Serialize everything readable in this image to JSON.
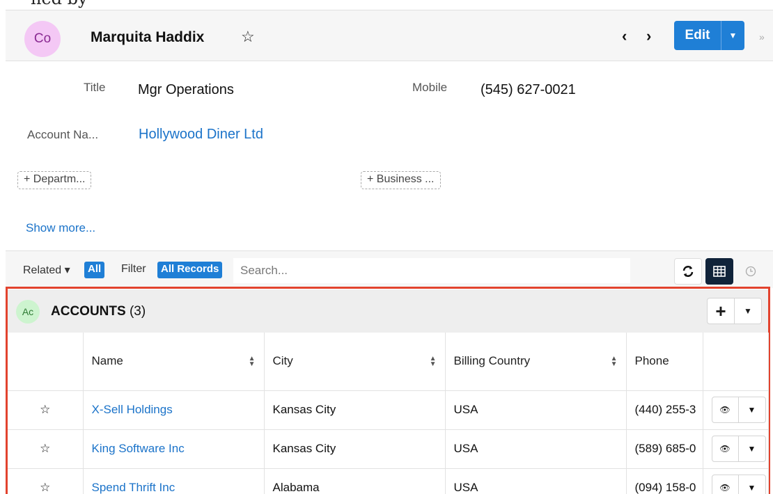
{
  "header": {
    "avatar_initials": "Co",
    "record_name": "Marquita Haddix",
    "favorite_icon": "star-outline-icon",
    "prev_icon": "chevron-left-icon",
    "next_icon": "chevron-right-icon",
    "edit_label": "Edit",
    "collapse_icon": "double-chevron-right-icon"
  },
  "fields": {
    "title_label": "Title",
    "title_value": "Mgr Operations",
    "mobile_label": "Mobile",
    "mobile_value": "(545) 627-0021",
    "account_label": "Account Na...",
    "account_value": "Hollywood Diner Ltd",
    "add_department": "+ Departm...",
    "add_business": "+ Business ...",
    "show_more": "Show more..."
  },
  "toolbar": {
    "related_label": "Related ▾",
    "related_value": "All",
    "filter_label": "Filter",
    "filter_value": "All Records",
    "search_placeholder": "Search..."
  },
  "subpanel": {
    "avatar_initials": "Ac",
    "title": "ACCOUNTS",
    "count": "(3)",
    "add_icon": "plus-icon",
    "columns": [
      "Name",
      "City",
      "Billing Country",
      "Phone"
    ],
    "rows": [
      {
        "name": "X-Sell Holdings",
        "city": "Kansas City",
        "country": "USA",
        "phone": "(440) 255-3"
      },
      {
        "name": "King Software Inc",
        "city": "Kansas City",
        "country": "USA",
        "phone": "(589) 685-0"
      },
      {
        "name": "Spend Thrift Inc",
        "city": "Alabama",
        "country": "USA",
        "phone": "(094) 158-0"
      }
    ]
  },
  "colors": {
    "accent": "#1f7fd6",
    "highlight_border": "#e2432e",
    "link": "#1b73c9"
  }
}
